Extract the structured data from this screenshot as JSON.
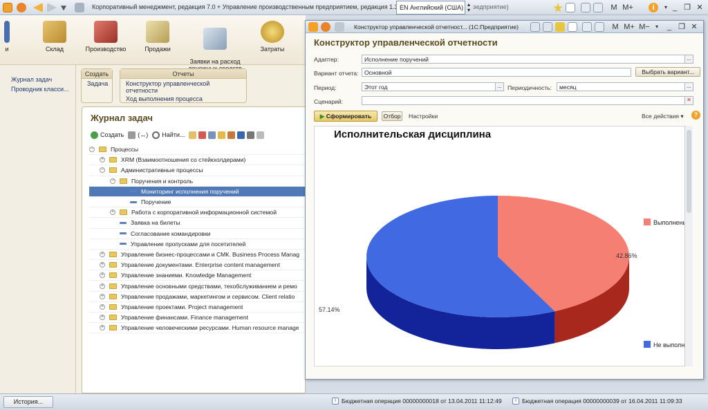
{
  "topbar": {
    "title": "Корпоративный менеджмент, редакция 7.0 + Управление производственным предприятием, редакция 1.3",
    "lang": "EN Английский (США)",
    "title_tail": "эедприятие)"
  },
  "sections": [
    {
      "label": "и",
      "icon": "chevron-icon",
      "color": "#4a6fb0"
    },
    {
      "label": "Склад",
      "icon": "warehouse-icon",
      "color": "#d9a646"
    },
    {
      "label": "Производство",
      "icon": "factory-icon",
      "color": "#c0504d"
    },
    {
      "label": "Продажи",
      "icon": "truck-icon",
      "color": "#c9b36a"
    },
    {
      "label": "Заявки на расход\nденежных средств",
      "icon": "clipboard-icon",
      "color": "#8aa0b8"
    },
    {
      "label": "Затраты",
      "icon": "coins-icon",
      "color": "#c7a13b"
    }
  ],
  "nav": {
    "items": [
      "Журнал задач",
      "Проводник класси..."
    ]
  },
  "groups": {
    "create": {
      "title": "Создать",
      "items": [
        "Задача"
      ]
    },
    "reports": {
      "title": "Отчеты",
      "items": [
        "Конструктор управленческой отчетности",
        "Ход выполнения процесса"
      ]
    }
  },
  "journal": {
    "title": "Журнал задач",
    "toolbar": {
      "create": "Создать",
      "find": "Найти..."
    },
    "tree": [
      {
        "level": 0,
        "type": "folder",
        "exp": "−",
        "label": "Процессы"
      },
      {
        "level": 1,
        "type": "folder",
        "exp": "+",
        "label": "XRM (Взаимоотношения со стейкхолдерами)"
      },
      {
        "level": 1,
        "type": "folder",
        "exp": "−",
        "label": "Административные процессы"
      },
      {
        "level": 2,
        "type": "folder",
        "exp": "−",
        "label": "Поручения и контроль"
      },
      {
        "level": 3,
        "type": "doc",
        "exp": "",
        "label": "Мониторинг исполнения поручений",
        "selected": true
      },
      {
        "level": 3,
        "type": "doc",
        "exp": "",
        "label": "Поручение"
      },
      {
        "level": 2,
        "type": "folder",
        "exp": "+",
        "label": "Работа с корпоративной информационной системой"
      },
      {
        "level": 2,
        "type": "doc",
        "exp": "",
        "label": "Заявка на билеты"
      },
      {
        "level": 2,
        "type": "doc",
        "exp": "",
        "label": "Согласование командировки"
      },
      {
        "level": 2,
        "type": "doc",
        "exp": "",
        "label": "Управление пропусками для посетителей"
      },
      {
        "level": 1,
        "type": "folder",
        "exp": "+",
        "label": "Управление бизнес-процессами и СМК. Business Process Manag"
      },
      {
        "level": 1,
        "type": "folder",
        "exp": "+",
        "label": "Управление документами. Enterprise content management"
      },
      {
        "level": 1,
        "type": "folder",
        "exp": "+",
        "label": "Управление знаниями. Knowledge Management"
      },
      {
        "level": 1,
        "type": "folder",
        "exp": "+",
        "label": "Управление основными средствами, техобслуживанием и ремо"
      },
      {
        "level": 1,
        "type": "folder",
        "exp": "+",
        "label": "Управление продажами, маркетингом и сервисом. Client relatio"
      },
      {
        "level": 1,
        "type": "folder",
        "exp": "+",
        "label": "Управление проектами. Project management"
      },
      {
        "level": 1,
        "type": "folder",
        "exp": "+",
        "label": "Управление финансами. Finance management"
      },
      {
        "level": 1,
        "type": "folder",
        "exp": "+",
        "label": "Управление человеческими ресурсами. Human resource manage"
      }
    ]
  },
  "report": {
    "window_title": "Конструктор управленческой отчетност... (1С:Предприятие)",
    "header": "Конструктор управленческой отчетности",
    "adapter_label": "Адаптер:",
    "adapter_value": "Исполнение поручений",
    "variant_label": "Вариант отчета:",
    "variant_value": "Основной",
    "variant_button": "Выбрать вариант...",
    "period_label": "Период:",
    "period_value": "Этот год",
    "periodicity_label": "Периодичность:",
    "periodicity_value": "месяц",
    "scenario_label": "Сценарий:",
    "scenario_value": "",
    "generate_button": "Сформировать",
    "filter_button": "Отбор",
    "settings_button": "Настройки",
    "all_actions": "Все действия",
    "help": "?"
  },
  "chart_data": {
    "type": "pie",
    "title": "Исполнительская дисциплина",
    "series": [
      {
        "name": "Выполнены",
        "value": 42.86,
        "label": "42.86%",
        "color": "#f47f72",
        "side": "#a8281d"
      },
      {
        "name": "Не выполне",
        "value": 57.14,
        "label": "57.14%",
        "color": "#4169e1",
        "side": "#13239a"
      }
    ],
    "legend": "right"
  },
  "status": {
    "history_button": "История...",
    "items": [
      "Бюджетная операция 00000000018 от 13.04.2011 11:12:49",
      "Бюджетная операция 00000000039 от 16.04.2011 11:09:33"
    ]
  }
}
